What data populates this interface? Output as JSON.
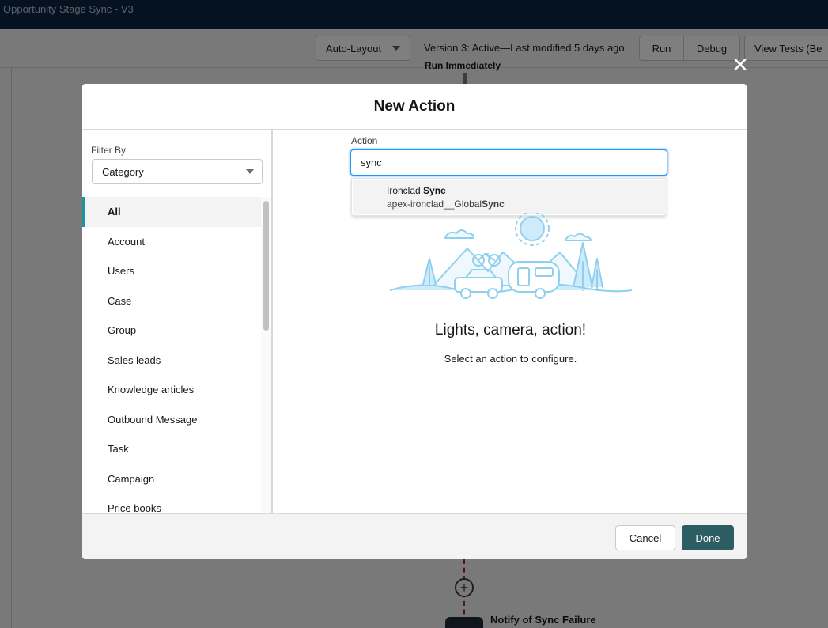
{
  "app": {
    "title": "Opportunity Stage Sync - V3"
  },
  "toolbar": {
    "layout_select": "Auto-Layout",
    "version_status": "Version 3: Active—Last modified 5 days ago",
    "run_label": "Run",
    "debug_label": "Debug",
    "view_tests_label": "View Tests (Be"
  },
  "canvas": {
    "top_node_label": "Run Immediately",
    "bottom_node_label": "Notify of Sync Failure"
  },
  "modal": {
    "title": "New Action",
    "filter": {
      "label": "Filter By",
      "selected": "Category",
      "categories": [
        "All",
        "Account",
        "Users",
        "Case",
        "Group",
        "Sales leads",
        "Knowledge articles",
        "Outbound Message",
        "Task",
        "Campaign",
        "Price books"
      ],
      "active_category": "All"
    },
    "action": {
      "label": "Action",
      "value": "sync",
      "results": [
        {
          "title_prefix": "Ironclad ",
          "title_match": "Sync",
          "subtitle_prefix": "apex-ironclad__Global",
          "subtitle_match": "Sync"
        }
      ]
    },
    "empty_state": {
      "title": "Lights, camera, action!",
      "subtitle": "Select an action to configure."
    },
    "footer": {
      "cancel_label": "Cancel",
      "done_label": "Done"
    }
  },
  "colors": {
    "header_bg": "#0b2444",
    "accent": "#1b96a0",
    "done_button": "#2b5d63",
    "flow_line": "#b21f2b",
    "illustration": "#8fd0f0"
  },
  "icons": {
    "close": "close-icon",
    "add_node": "plus-circle-icon"
  }
}
